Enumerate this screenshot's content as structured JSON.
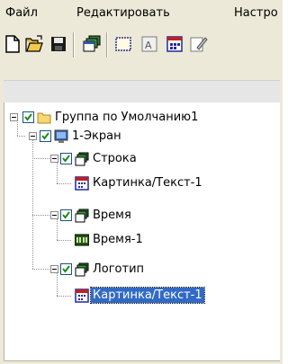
{
  "menu": {
    "file": "Файл",
    "edit": "Редактировать",
    "settings": "Настро"
  },
  "toolbar": {
    "buttons": [
      "new-icon",
      "open-folder-icon",
      "save-icon",
      "screen-windows-icon",
      "frame-icon",
      "text-image-icon",
      "calendar-icon",
      "edit-icon"
    ]
  },
  "tree": {
    "root": {
      "label": "Группа по Умолчанию1",
      "checked": true,
      "icon": "folder-icon"
    },
    "screen": {
      "label": "1-Экран",
      "checked": true,
      "icon": "monitor-icon"
    },
    "nodes": [
      {
        "label": "Строка",
        "checked": true,
        "icon": "windows-stack-icon",
        "child": {
          "label": "Картинка/Текст-1",
          "icon": "picture-text-icon",
          "selected": false
        }
      },
      {
        "label": "Время",
        "checked": true,
        "icon": "windows-stack-icon",
        "child": {
          "label": "Время-1",
          "icon": "clock-display-icon",
          "selected": false
        }
      },
      {
        "label": "Логотип",
        "checked": true,
        "icon": "windows-stack-icon",
        "child": {
          "label": "Картинка/Текст-1",
          "icon": "picture-text-icon",
          "selected": true
        }
      }
    ]
  },
  "colors": {
    "selection": "#316ac5",
    "background": "#ece9d8"
  }
}
